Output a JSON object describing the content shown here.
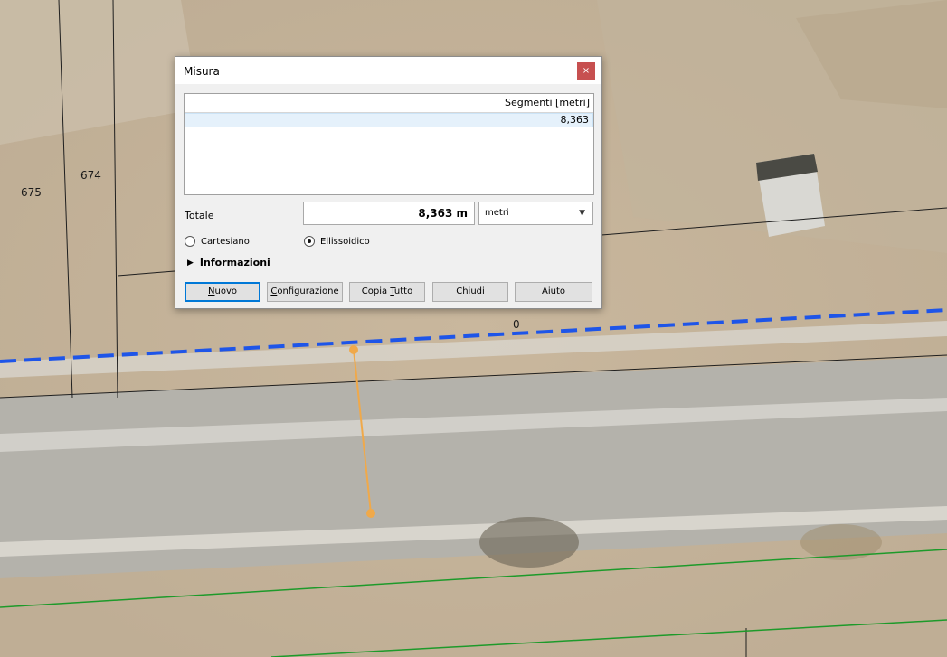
{
  "map": {
    "parcel_labels": [
      "675",
      "674"
    ],
    "road_label": "0",
    "colors": {
      "boundary_line": "#1f1f1f",
      "dashed_line": "#1e55e8",
      "green_line": "#1d9a2a",
      "measure_line": "#f0a94a"
    }
  },
  "dialog": {
    "title": "Misura",
    "close_icon": "×",
    "table": {
      "header": "Segmenti [metri]",
      "rows": [
        "8,363"
      ]
    },
    "total_label": "Totale",
    "total_value": "8,363 m",
    "unit_selected": "metri",
    "radio_cartesian": "Cartesiano",
    "radio_ellipsoidal": "Ellissoidico",
    "radio_selected": "ellipsoidal",
    "info_label": "Informazioni",
    "buttons": {
      "new": {
        "pre": "",
        "mn": "N",
        "post": "uovo"
      },
      "config": {
        "pre": "",
        "mn": "C",
        "post": "onfigurazione"
      },
      "copy_all": {
        "pre": "Copia ",
        "mn": "T",
        "post": "utto"
      },
      "close": {
        "pre": "",
        "mn": "",
        "post": "Chiudi"
      },
      "help": {
        "pre": "",
        "mn": "",
        "post": "Aiuto"
      }
    }
  }
}
